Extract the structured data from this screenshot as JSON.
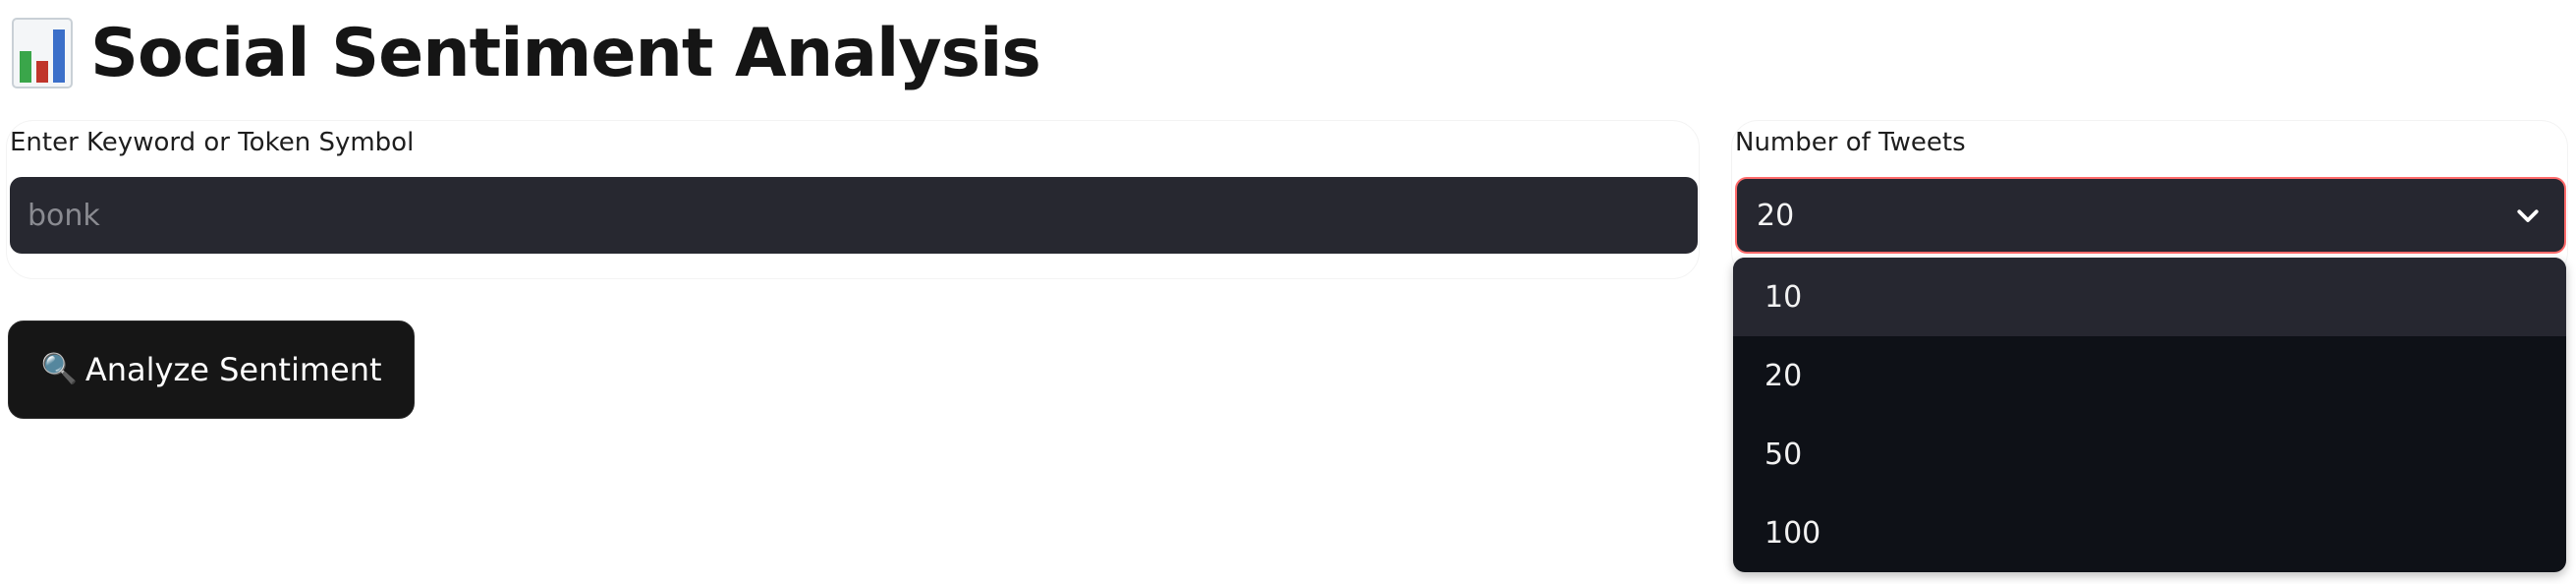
{
  "header": {
    "title": "Social Sentiment Analysis",
    "icon": "bar-chart-icon"
  },
  "keyword_field": {
    "label": "Enter Keyword or Token Symbol",
    "value": "",
    "placeholder": "bonk"
  },
  "tweets_field": {
    "label": "Number of Tweets",
    "selected": "20",
    "dropdown_open": true,
    "options": [
      "10",
      "20",
      "50",
      "100"
    ],
    "highlighted_option": "10"
  },
  "analyze_button": {
    "icon": "magnifier-icon",
    "label": "Analyze Sentiment"
  },
  "colors": {
    "input_bg": "#262730",
    "dropdown_bg": "#0e1117",
    "focus_border": "#ff6b6b",
    "button_bg": "#161616",
    "chart_green": "#3aa64a",
    "chart_red": "#c0352b",
    "chart_blue": "#3b6fc9"
  }
}
